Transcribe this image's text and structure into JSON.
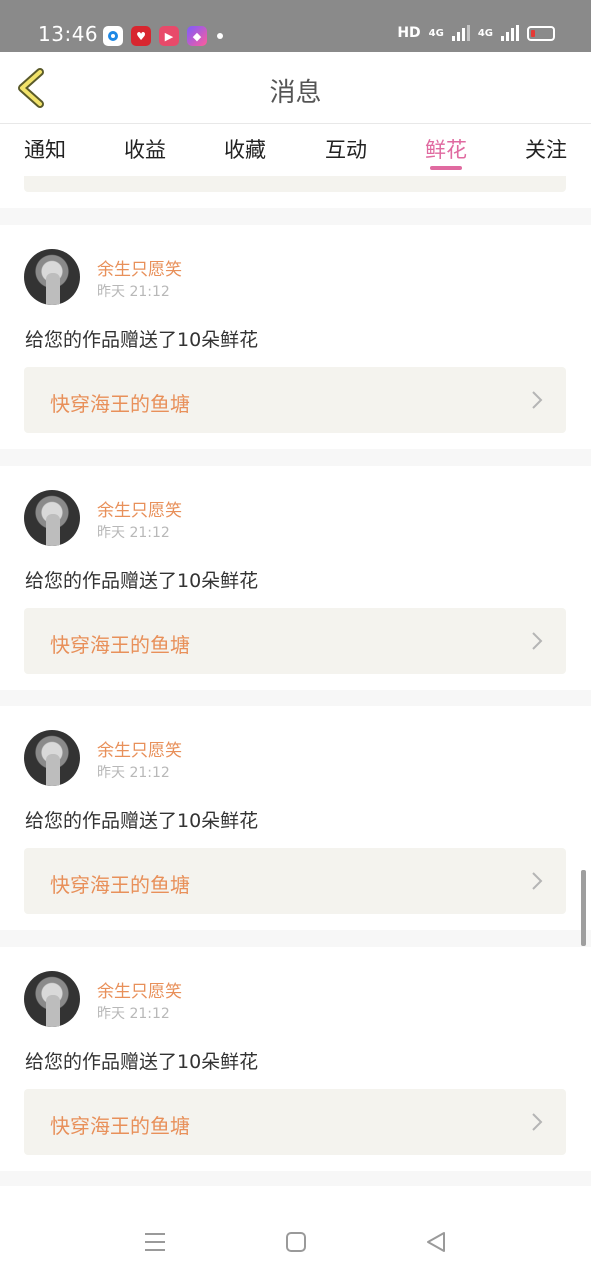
{
  "status_bar": {
    "time": "13:46",
    "network_label": "HD",
    "signal1_label": "4G",
    "signal2_label": "4G"
  },
  "header": {
    "title": "消息",
    "back_icon": "chevron-left-icon"
  },
  "tabs": [
    {
      "label": "通知",
      "active": false
    },
    {
      "label": "收益",
      "active": false
    },
    {
      "label": "收藏",
      "active": false
    },
    {
      "label": "互动",
      "active": false
    },
    {
      "label": "鲜花",
      "active": true
    },
    {
      "label": "关注",
      "active": false
    }
  ],
  "colors": {
    "accent_pink": "#e06aa0",
    "username_orange": "#e8905a",
    "box_bg": "#f4f3ee"
  },
  "messages": [
    {
      "username": "余生只愿笑",
      "time": "昨天 21:12",
      "text": "给您的作品赠送了10朵鲜花",
      "work_title": "快穿海王的鱼塘"
    },
    {
      "username": "余生只愿笑",
      "time": "昨天 21:12",
      "text": "给您的作品赠送了10朵鲜花",
      "work_title": "快穿海王的鱼塘"
    },
    {
      "username": "余生只愿笑",
      "time": "昨天 21:12",
      "text": "给您的作品赠送了10朵鲜花",
      "work_title": "快穿海王的鱼塘"
    },
    {
      "username": "余生只愿笑",
      "time": "昨天 21:12",
      "text": "给您的作品赠送了10朵鲜花",
      "work_title": "快穿海王的鱼塘"
    }
  ],
  "nav_bar": {
    "menu_icon": "menu-icon",
    "home_icon": "home-square-icon",
    "back_icon": "back-triangle-icon"
  }
}
